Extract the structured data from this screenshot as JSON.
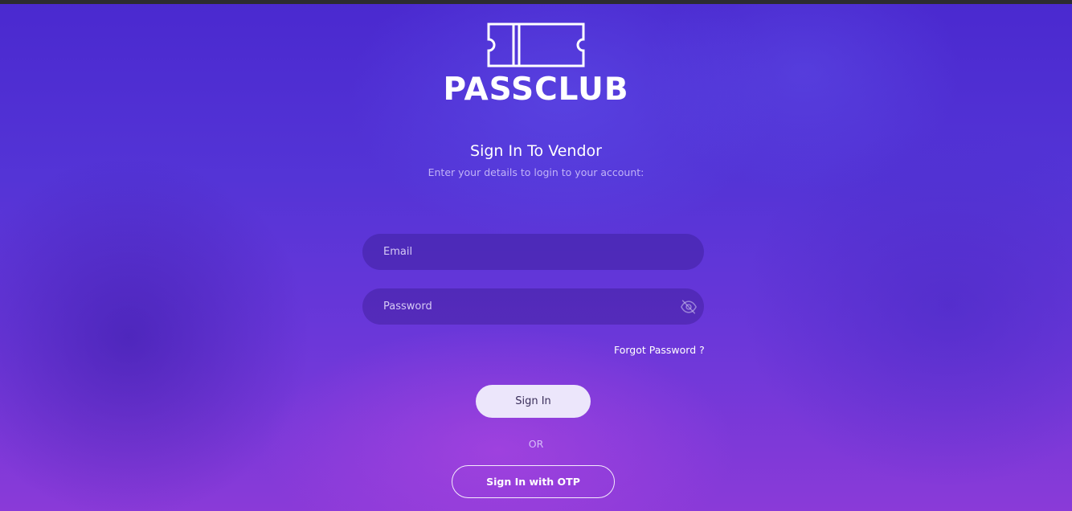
{
  "brand": {
    "name": "PASSCLUB",
    "logo_icon": "ticket-icon"
  },
  "login": {
    "title": "Sign In To Vendor",
    "subtitle": "Enter your details to login to your account:",
    "email": {
      "value": "",
      "placeholder": "Email"
    },
    "password": {
      "value": "",
      "placeholder": "Password",
      "toggle_icon": "eye-slash-icon"
    },
    "forgot_password_label": "Forgot Password ?",
    "sign_in_label": "Sign In",
    "divider_label": "OR",
    "sign_in_otp_label": "Sign In with OTP"
  },
  "colors": {
    "background_primary": "#5434d6",
    "background_accent": "#8a3ad8",
    "button_fill": "#ece6fb",
    "button_text": "#3a2e5a",
    "text_primary": "#ffffff"
  }
}
